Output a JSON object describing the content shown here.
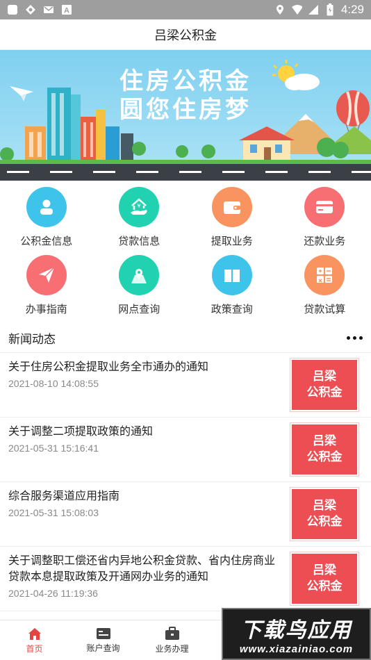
{
  "status_bar": {
    "left_icons": [
      "app-icon",
      "sync-icon",
      "message-icon",
      "font-app-icon"
    ],
    "right_icons": [
      "location-icon",
      "wifi-icon",
      "signal-icon",
      "battery-icon"
    ],
    "time": "4:29",
    "color": "#9e9e9e"
  },
  "header": {
    "title": "吕梁公积金"
  },
  "banner": {
    "line1": "住房公积金",
    "line2": "圆您住房梦",
    "sky_color": "#8fd5f1"
  },
  "grid": {
    "items": [
      {
        "label": "公积金信息",
        "icon": "user-icon",
        "color": "#3ec3eb"
      },
      {
        "label": "贷款信息",
        "icon": "house-loan-icon",
        "color": "#21d2b0"
      },
      {
        "label": "提取业务",
        "icon": "wallet-icon",
        "color": "#f99461"
      },
      {
        "label": "还款业务",
        "icon": "card-icon",
        "color": "#f86f73"
      },
      {
        "label": "办事指南",
        "icon": "send-icon",
        "color": "#f86f73"
      },
      {
        "label": "网点查询",
        "icon": "map-pin-icon",
        "color": "#21d2b0"
      },
      {
        "label": "政策查询",
        "icon": "book-icon",
        "color": "#3ec3eb"
      },
      {
        "label": "贷款试算",
        "icon": "calculator-icon",
        "color": "#f99461"
      }
    ]
  },
  "news": {
    "title": "新闻动态",
    "thumb_line1": "吕梁",
    "thumb_line2": "公积金",
    "items": [
      {
        "text": "关于住房公积金提取业务全市通办的通知",
        "date": "2021-08-10 14:08:55"
      },
      {
        "text": "关于调整二项提取政策的通知",
        "date": "2021-05-31 15:16:41"
      },
      {
        "text": "综合服务渠道应用指南",
        "date": "2021-05-31 15:08:03"
      },
      {
        "text": "关于调整职工偿还省内异地公积金贷款、省内住房商业贷款本息提取政策及开通网办业务的通知",
        "date": "2021-04-26 11:19:36"
      }
    ]
  },
  "bottom_nav": {
    "items": [
      {
        "label": "首页",
        "icon": "home-icon",
        "active": true
      },
      {
        "label": "账户查询",
        "icon": "id-card-icon",
        "active": false
      },
      {
        "label": "业务办理",
        "icon": "briefcase-icon",
        "active": false
      }
    ],
    "active_color": "#e64340"
  },
  "watermark": {
    "big": "下载鸟应用",
    "small": "www.xiazainiao.com"
  }
}
